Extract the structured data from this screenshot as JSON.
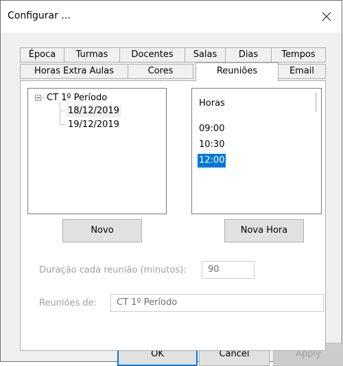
{
  "window": {
    "title": "Configurar ..."
  },
  "tabs": {
    "row1": [
      "Época",
      "Turmas",
      "Docentes",
      "Salas",
      "Dias",
      "Tempos"
    ],
    "row2": [
      "Horas Extra Aulas",
      "Cores",
      "Reuniões",
      "Email"
    ],
    "active": "Reuniões"
  },
  "tree": {
    "root": "CT 1º Período",
    "children": [
      "18/12/2019",
      "19/12/2019"
    ],
    "selected": "18/12/2019"
  },
  "hours_list": {
    "header": "Horas",
    "items": [
      "09:00",
      "10:30",
      "12:00"
    ],
    "selected": "12:00"
  },
  "buttons": {
    "novo": "Novo",
    "nova_hora": "Nova Hora"
  },
  "duration": {
    "label": "Duração cada reunião (minutos):",
    "value": "90"
  },
  "meetings_of": {
    "label": "Reuniões de:",
    "value": "CT 1º Período"
  },
  "footer": {
    "ok": "OK",
    "cancel": "Cancel",
    "apply": "Apply"
  },
  "colors": {
    "accent": "#0078d7",
    "border": "#adadad",
    "disabled_text": "#a0a0a0"
  }
}
